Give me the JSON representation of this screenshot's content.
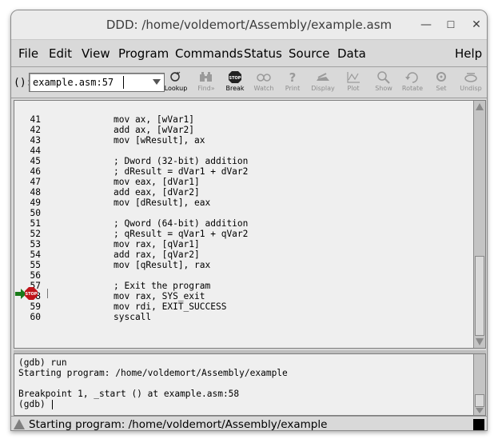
{
  "window": {
    "title": "DDD: /home/voldemort/Assembly/example.asm",
    "minimize_icon": "minimize-icon",
    "maximize_icon": "maximize-icon",
    "close_icon": "close-icon"
  },
  "menubar": {
    "items": [
      "File",
      "Edit",
      "View",
      "Program",
      "Commands",
      "Status",
      "Source",
      "Data"
    ],
    "help": "Help"
  },
  "toolbar": {
    "arg_label": "():",
    "arg_value": "example.asm:57",
    "buttons": [
      {
        "label": "Lookup",
        "icon": "lookup-icon",
        "enabled": true
      },
      {
        "label": "Find»",
        "icon": "find-icon",
        "enabled": false
      },
      {
        "label": "Break",
        "icon": "stop-sign-icon",
        "enabled": true
      },
      {
        "label": "Watch",
        "icon": "watch-icon",
        "enabled": false
      },
      {
        "label": "Print",
        "icon": "print-icon",
        "enabled": false
      },
      {
        "label": "Display",
        "icon": "display-icon",
        "enabled": false
      },
      {
        "label": "Plot",
        "icon": "plot-icon",
        "enabled": false
      },
      {
        "label": "Show",
        "icon": "show-icon",
        "enabled": false
      },
      {
        "label": "Rotate",
        "icon": "rotate-icon",
        "enabled": false
      },
      {
        "label": "Set",
        "icon": "set-icon",
        "enabled": false
      },
      {
        "label": "Undisp",
        "icon": "undisp-icon",
        "enabled": false
      }
    ]
  },
  "source": {
    "lines": [
      {
        "num": "41",
        "code": "mov ax, [wVar1]"
      },
      {
        "num": "42",
        "code": "add ax, [wVar2]"
      },
      {
        "num": "43",
        "code": "mov [wResult], ax"
      },
      {
        "num": "44",
        "code": ""
      },
      {
        "num": "45",
        "code": "; Dword (32-bit) addition"
      },
      {
        "num": "46",
        "code": "; dResult = dVar1 + dVar2"
      },
      {
        "num": "47",
        "code": "mov eax, [dVar1]"
      },
      {
        "num": "48",
        "code": "add eax, [dVar2]"
      },
      {
        "num": "49",
        "code": "mov [dResult], eax"
      },
      {
        "num": "50",
        "code": ""
      },
      {
        "num": "51",
        "code": "; Qword (64-bit) addition"
      },
      {
        "num": "52",
        "code": "; qResult = qVar1 + qVar2"
      },
      {
        "num": "53",
        "code": "mov rax, [qVar1]"
      },
      {
        "num": "54",
        "code": "add rax, [qVar2]"
      },
      {
        "num": "55",
        "code": "mov [qResult], rax"
      },
      {
        "num": "56",
        "code": ""
      },
      {
        "num": "57",
        "code": "; Exit the program"
      },
      {
        "num": "58",
        "code": "mov rax, SYS_exit"
      },
      {
        "num": "59",
        "code": "mov rdi, EXIT_SUCCESS"
      },
      {
        "num": "60",
        "code": "syscall"
      }
    ],
    "current_line": "58",
    "breakpoint_icon": "stop-sign-icon",
    "execution_arrow_icon": "execution-arrow-icon"
  },
  "console": {
    "lines": [
      "(gdb) run",
      "Starting program: /home/voldemort/Assembly/example",
      "",
      "Breakpoint 1, _start () at example.asm:58",
      "(gdb) "
    ]
  },
  "statusbar": {
    "text": "Starting program: /home/voldemort/Assembly/example",
    "icon": "warning-triangle-icon"
  },
  "colors": {
    "window_bg": "#d9d9d9",
    "pane_bg": "#efefef",
    "stop_red": "#c0141a",
    "arrow_green": "#1a7a1a"
  }
}
